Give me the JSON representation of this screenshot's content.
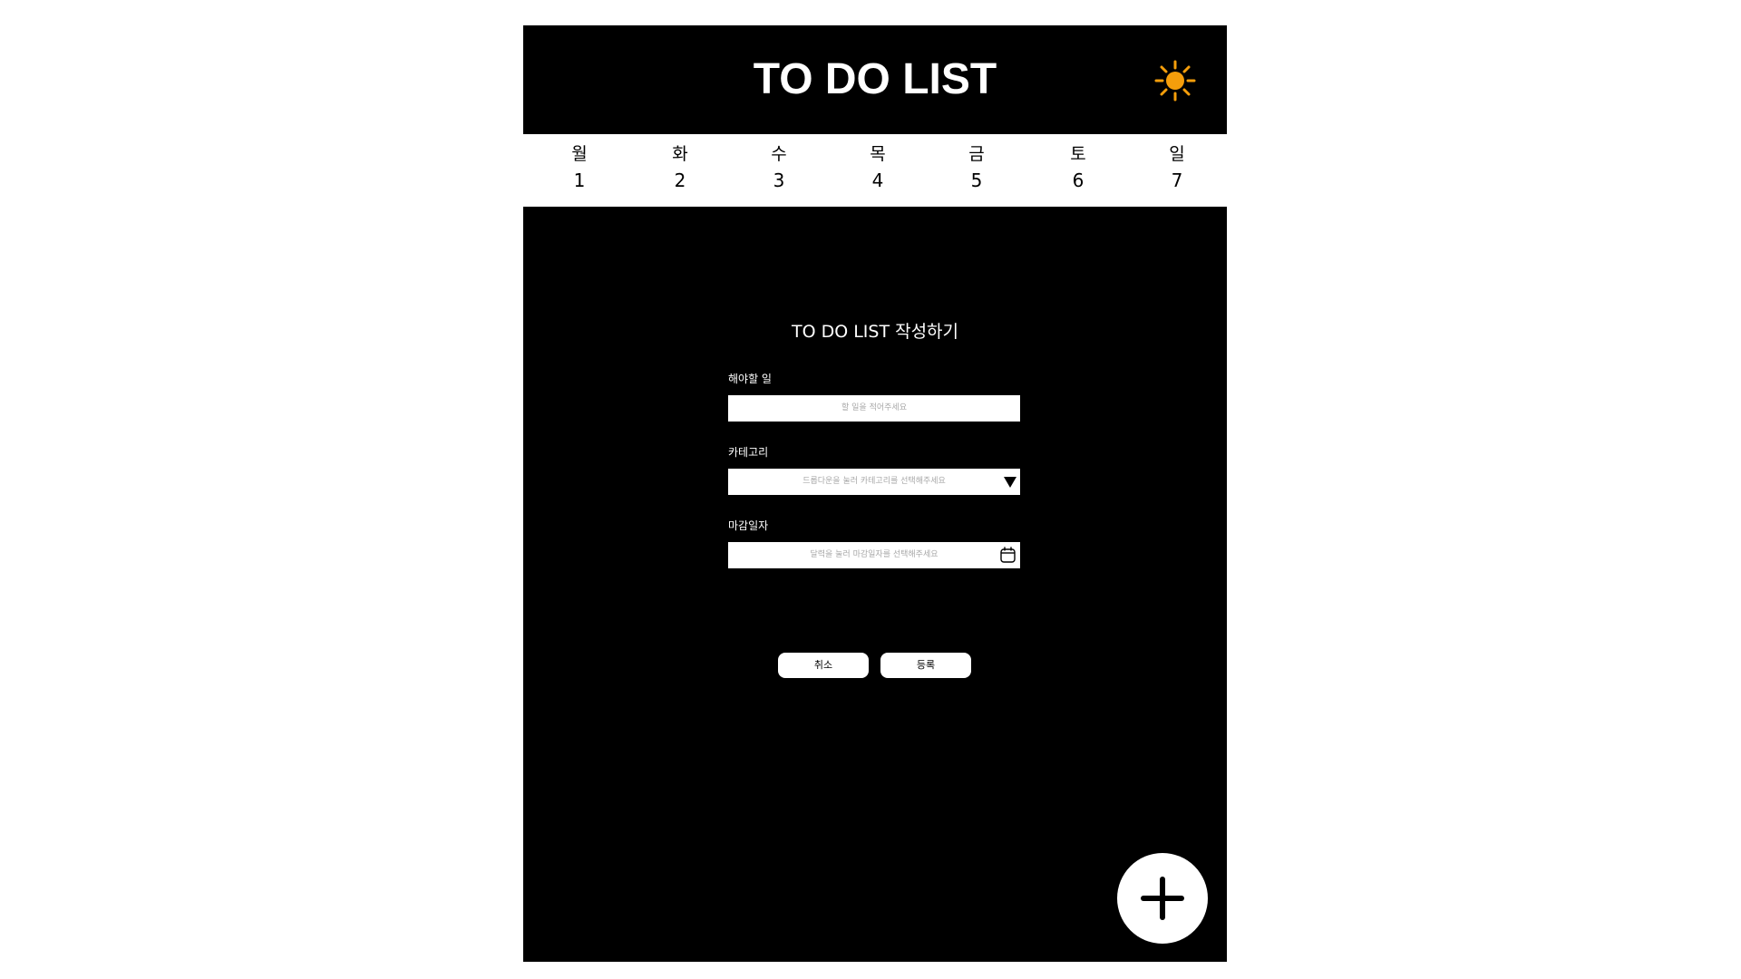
{
  "header": {
    "title": "TO DO LIST",
    "theme_icon": "sun-icon",
    "theme_color": "#F59E0B"
  },
  "week": {
    "days": [
      {
        "dow": "월",
        "num": "1"
      },
      {
        "dow": "화",
        "num": "2"
      },
      {
        "dow": "수",
        "num": "3"
      },
      {
        "dow": "목",
        "num": "4"
      },
      {
        "dow": "금",
        "num": "5"
      },
      {
        "dow": "토",
        "num": "6"
      },
      {
        "dow": "일",
        "num": "7"
      }
    ]
  },
  "form": {
    "title": "TO DO LIST 작성하기",
    "task": {
      "label": "해야할 일",
      "placeholder": "할 일을 적어주세요"
    },
    "category": {
      "label": "카테고리",
      "placeholder": "드롭다운을 눌러 카테고리를 선택해주세요",
      "icon": "dropdown-triangle-icon"
    },
    "deadline": {
      "label": "마감일자",
      "placeholder": "달력을 눌러 마감일자를 선택해주세요",
      "icon": "calendar-icon"
    },
    "cancel_label": "취소",
    "submit_label": "등록"
  },
  "fab": {
    "icon": "plus-icon"
  }
}
